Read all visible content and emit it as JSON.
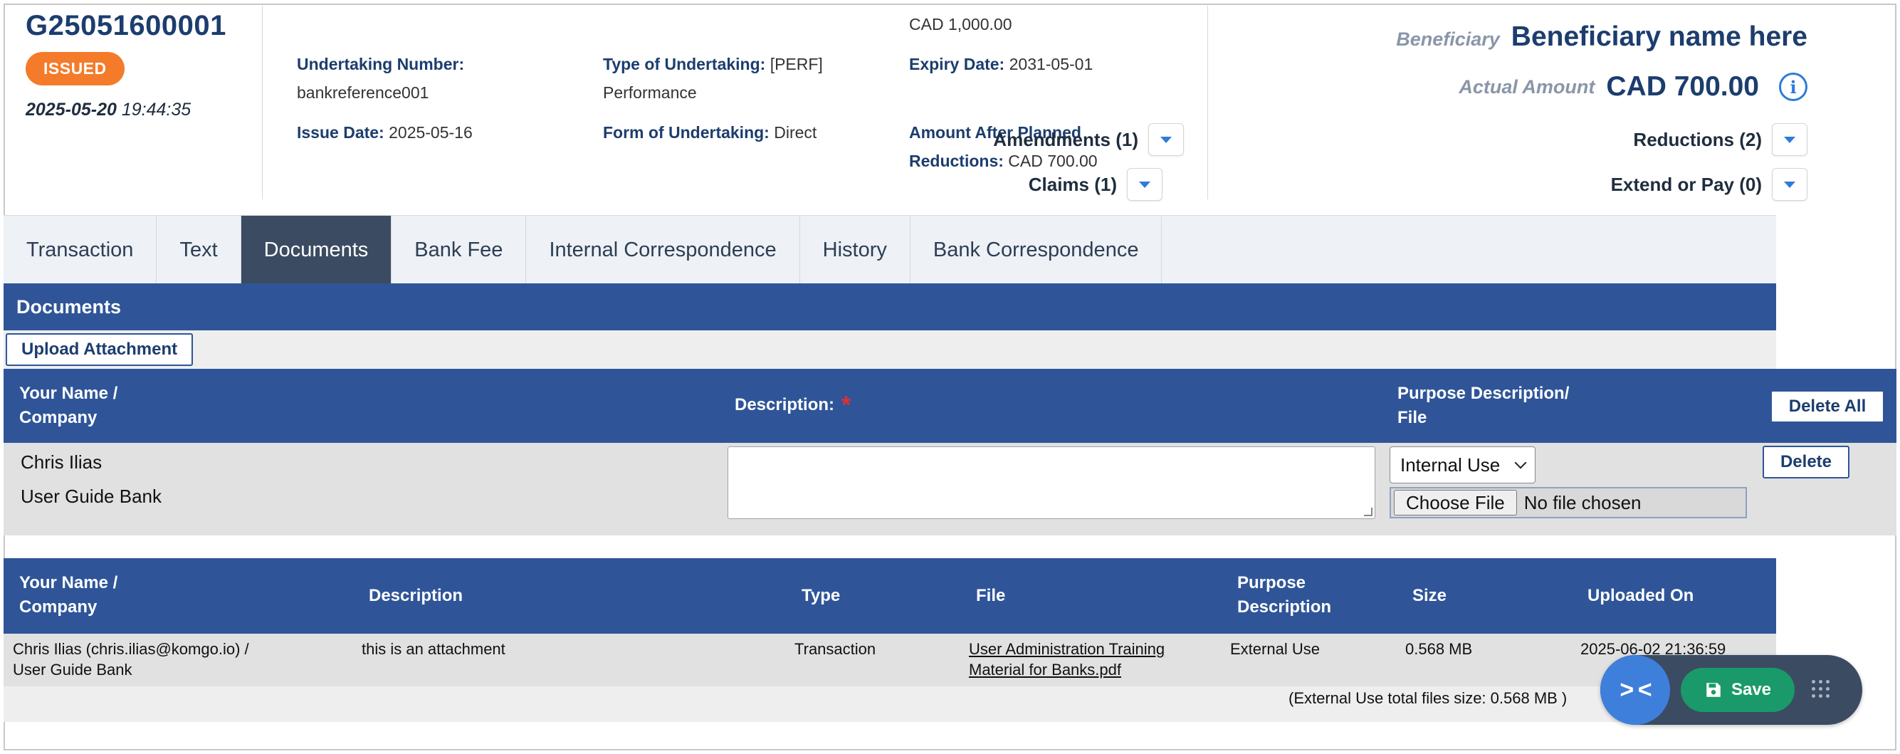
{
  "summary": {
    "reference": "G25051600001",
    "status": "ISSUED",
    "issued_date": "2025-05-20",
    "issued_time": "19:44:35"
  },
  "fields": {
    "top_amount": "CAD 1,000.00",
    "undertaking_number_label": "Undertaking Number:",
    "undertaking_number": "bankreference001",
    "issue_date_label": "Issue Date:",
    "issue_date": "2025-05-16",
    "type_label": "Type of Undertaking:",
    "type_code": "[PERF]",
    "type_name": "Performance",
    "form_label": "Form of Undertaking:",
    "form_value": "Direct",
    "expiry_label": "Expiry Date:",
    "expiry_value": "2031-05-01",
    "after_reductions_label_1": "Amount After Planned",
    "after_reductions_label_2": "Reductions:",
    "after_reductions_value": "CAD 700.00"
  },
  "beneficiary": {
    "label": "Beneficiary",
    "name": "Beneficiary name here",
    "actual_amount_label": "Actual Amount",
    "actual_amount": "CAD 700.00"
  },
  "counters": {
    "amendments": "Amendments (1)",
    "reductions": "Reductions (2)",
    "claims": "Claims (1)",
    "extend_or_pay": "Extend or Pay (0)"
  },
  "tabs": [
    {
      "label": "Transaction",
      "active": false
    },
    {
      "label": "Text",
      "active": false
    },
    {
      "label": "Documents",
      "active": true
    },
    {
      "label": "Bank Fee",
      "active": false
    },
    {
      "label": "Internal Correspondence",
      "active": false
    },
    {
      "label": "History",
      "active": false
    },
    {
      "label": "Bank Correspondence",
      "active": false
    }
  ],
  "documents": {
    "section_title": "Documents",
    "upload_button": "Upload Attachment",
    "form_header": {
      "name_col_1": "Your Name /",
      "name_col_2": "Company",
      "description": "Description:",
      "required_mark": "*",
      "purpose_col_1": "Purpose Description/",
      "purpose_col_2": "File",
      "delete_all": "Delete All"
    },
    "form_row": {
      "user_name": "Chris Ilias",
      "company": "User Guide Bank",
      "description_value": "",
      "purpose_selected": "Internal Use",
      "choose_file": "Choose File",
      "no_file": "No file chosen",
      "delete": "Delete"
    },
    "table": {
      "headers": {
        "name_1": "Your Name /",
        "name_2": "Company",
        "description": "Description",
        "type": "Type",
        "file": "File",
        "purpose_1": "Purpose",
        "purpose_2": "Description",
        "size": "Size",
        "uploaded_on": "Uploaded On"
      },
      "rows": [
        {
          "name_1": "Chris Ilias (chris.ilias@komgo.io) /",
          "name_2": "User Guide Bank",
          "description": "this is an attachment",
          "type": "Transaction",
          "file_1": "User Administration Training",
          "file_2": "Material for Banks.pdf",
          "purpose": "External Use",
          "size": "0.568 MB",
          "uploaded_on": "2025-06-02 21:36:59"
        }
      ],
      "footer": "(External Use total files size: 0.568 MB )"
    }
  },
  "toolbar": {
    "collapse_glyph": "> <",
    "save_label": "Save"
  },
  "colors": {
    "navy": "#1c3d6e",
    "header_blue": "#2f5598",
    "issued_orange": "#f47b2a",
    "active_tab": "#3b4b62",
    "save_green": "#1a9a6a",
    "accent_blue": "#2e7bd8"
  }
}
